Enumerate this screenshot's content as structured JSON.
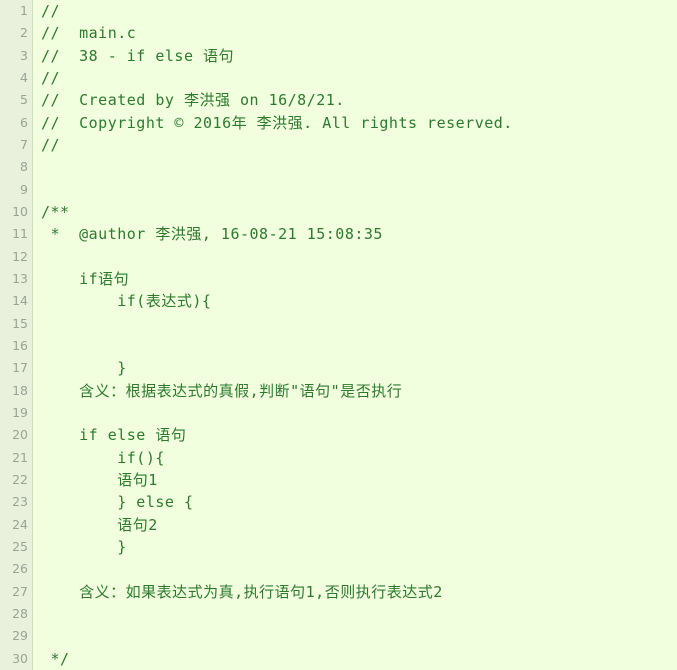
{
  "editor": {
    "language": "c",
    "total_lines": 30,
    "colors": {
      "background": "#f1ffdf",
      "gutter_background": "#e9f1dd",
      "gutter_separator": "#cfdcc0",
      "line_number": "#9aa394",
      "comment_text": "#2d7a2d"
    },
    "lines": [
      {
        "number": "1",
        "text": "//"
      },
      {
        "number": "2",
        "text": "//  main.c"
      },
      {
        "number": "3",
        "text": "//  38 - if else 语句"
      },
      {
        "number": "4",
        "text": "//"
      },
      {
        "number": "5",
        "text": "//  Created by 李洪强 on 16/8/21."
      },
      {
        "number": "6",
        "text": "//  Copyright © 2016年 李洪强. All rights reserved."
      },
      {
        "number": "7",
        "text": "//"
      },
      {
        "number": "8",
        "text": ""
      },
      {
        "number": "9",
        "text": ""
      },
      {
        "number": "10",
        "text": "/**"
      },
      {
        "number": "11",
        "text": " *  @author 李洪强, 16-08-21 15:08:35"
      },
      {
        "number": "12",
        "text": ""
      },
      {
        "number": "13",
        "text": "    if语句"
      },
      {
        "number": "14",
        "text": "        if(表达式){"
      },
      {
        "number": "15",
        "text": ""
      },
      {
        "number": "16",
        "text": ""
      },
      {
        "number": "17",
        "text": "        }"
      },
      {
        "number": "18",
        "text": "    含义：根据表达式的真假,判断\"语句\"是否执行"
      },
      {
        "number": "19",
        "text": ""
      },
      {
        "number": "20",
        "text": "    if else 语句"
      },
      {
        "number": "21",
        "text": "        if(){"
      },
      {
        "number": "22",
        "text": "        语句1"
      },
      {
        "number": "23",
        "text": "        } else {"
      },
      {
        "number": "24",
        "text": "        语句2"
      },
      {
        "number": "25",
        "text": "        }"
      },
      {
        "number": "26",
        "text": ""
      },
      {
        "number": "27",
        "text": "    含义：如果表达式为真,执行语句1,否则执行表达式2"
      },
      {
        "number": "28",
        "text": ""
      },
      {
        "number": "29",
        "text": ""
      },
      {
        "number": "30",
        "text": " */"
      }
    ]
  }
}
